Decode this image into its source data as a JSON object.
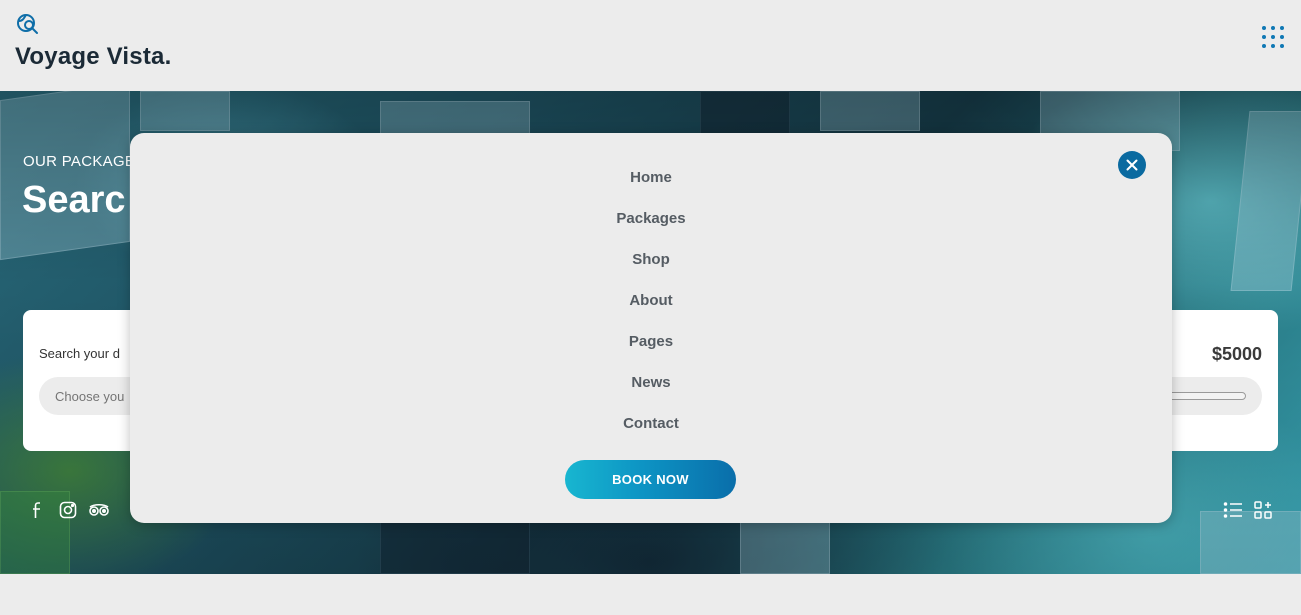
{
  "header": {
    "brand": "Voyage Vista.",
    "logo_icon": "globe-search-icon",
    "menu_icon": "grid-dots-icon"
  },
  "hero": {
    "eyebrow": "OUR PACKAGE",
    "heading": "Searc",
    "search": {
      "label": "Search your d",
      "placeholder": "Choose you",
      "price": "$5000"
    },
    "social_icons": [
      "facebook-icon",
      "instagram-icon",
      "tripadvisor-icon"
    ],
    "view_icons": [
      "list-view-icon",
      "grid-view-icon"
    ]
  },
  "modal": {
    "close_icon": "close-icon",
    "nav": [
      {
        "label": "Home"
      },
      {
        "label": "Packages"
      },
      {
        "label": "Shop"
      },
      {
        "label": "About"
      },
      {
        "label": "Pages"
      },
      {
        "label": "News"
      },
      {
        "label": "Contact"
      }
    ],
    "cta": "BOOK NOW"
  },
  "colors": {
    "accent": "#0a6aa0",
    "cta_start": "#18b6d0",
    "cta_end": "#0a6eaa",
    "background": "#ececec",
    "brand_text": "#1b2a36"
  }
}
